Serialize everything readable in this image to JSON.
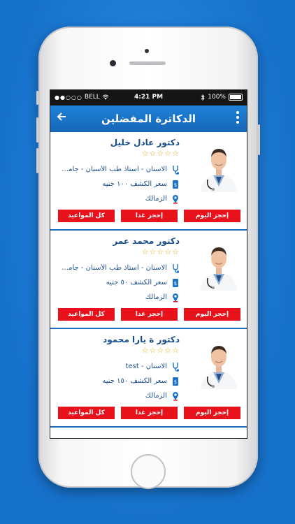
{
  "status_bar": {
    "carrier": "BELL",
    "time": "4:21 PM",
    "battery": "100%"
  },
  "header": {
    "title": "الدكاترة المفضلين"
  },
  "doctors": [
    {
      "name": "دكتور عادل خليل",
      "specialty": "الاسنان - أستاذ طب الأسنان - جامعة...",
      "fee": "سعر الكشف ١٠٠ جنيه",
      "location": "الزمالك",
      "rating": 0
    },
    {
      "name": "دكتور محمد عمر",
      "specialty": "الاسنان - أستاذ طب الأسنان - جامعة...",
      "fee": "سعر الكشف ٥٠ جنيه",
      "location": "الزمالك",
      "rating": 0
    },
    {
      "name": "دكتور ة يارا محمود",
      "specialty": "الاسنان - test",
      "fee": "سعر الكشف ١٥٠ جنيه",
      "location": "الزمالك",
      "rating": 0
    }
  ],
  "buttons": {
    "today": "إحجز اليوم",
    "tomorrow": "إحجز غدا",
    "all": "كل المواعيد"
  },
  "colors": {
    "accent": "#1a73c8",
    "button": "#e8121c",
    "star": "#e7a916"
  },
  "icons": [
    "back-arrow-icon",
    "more-vertical-icon",
    "stethoscope-icon",
    "money-icon",
    "location-pin-icon",
    "star-outline-icon"
  ]
}
